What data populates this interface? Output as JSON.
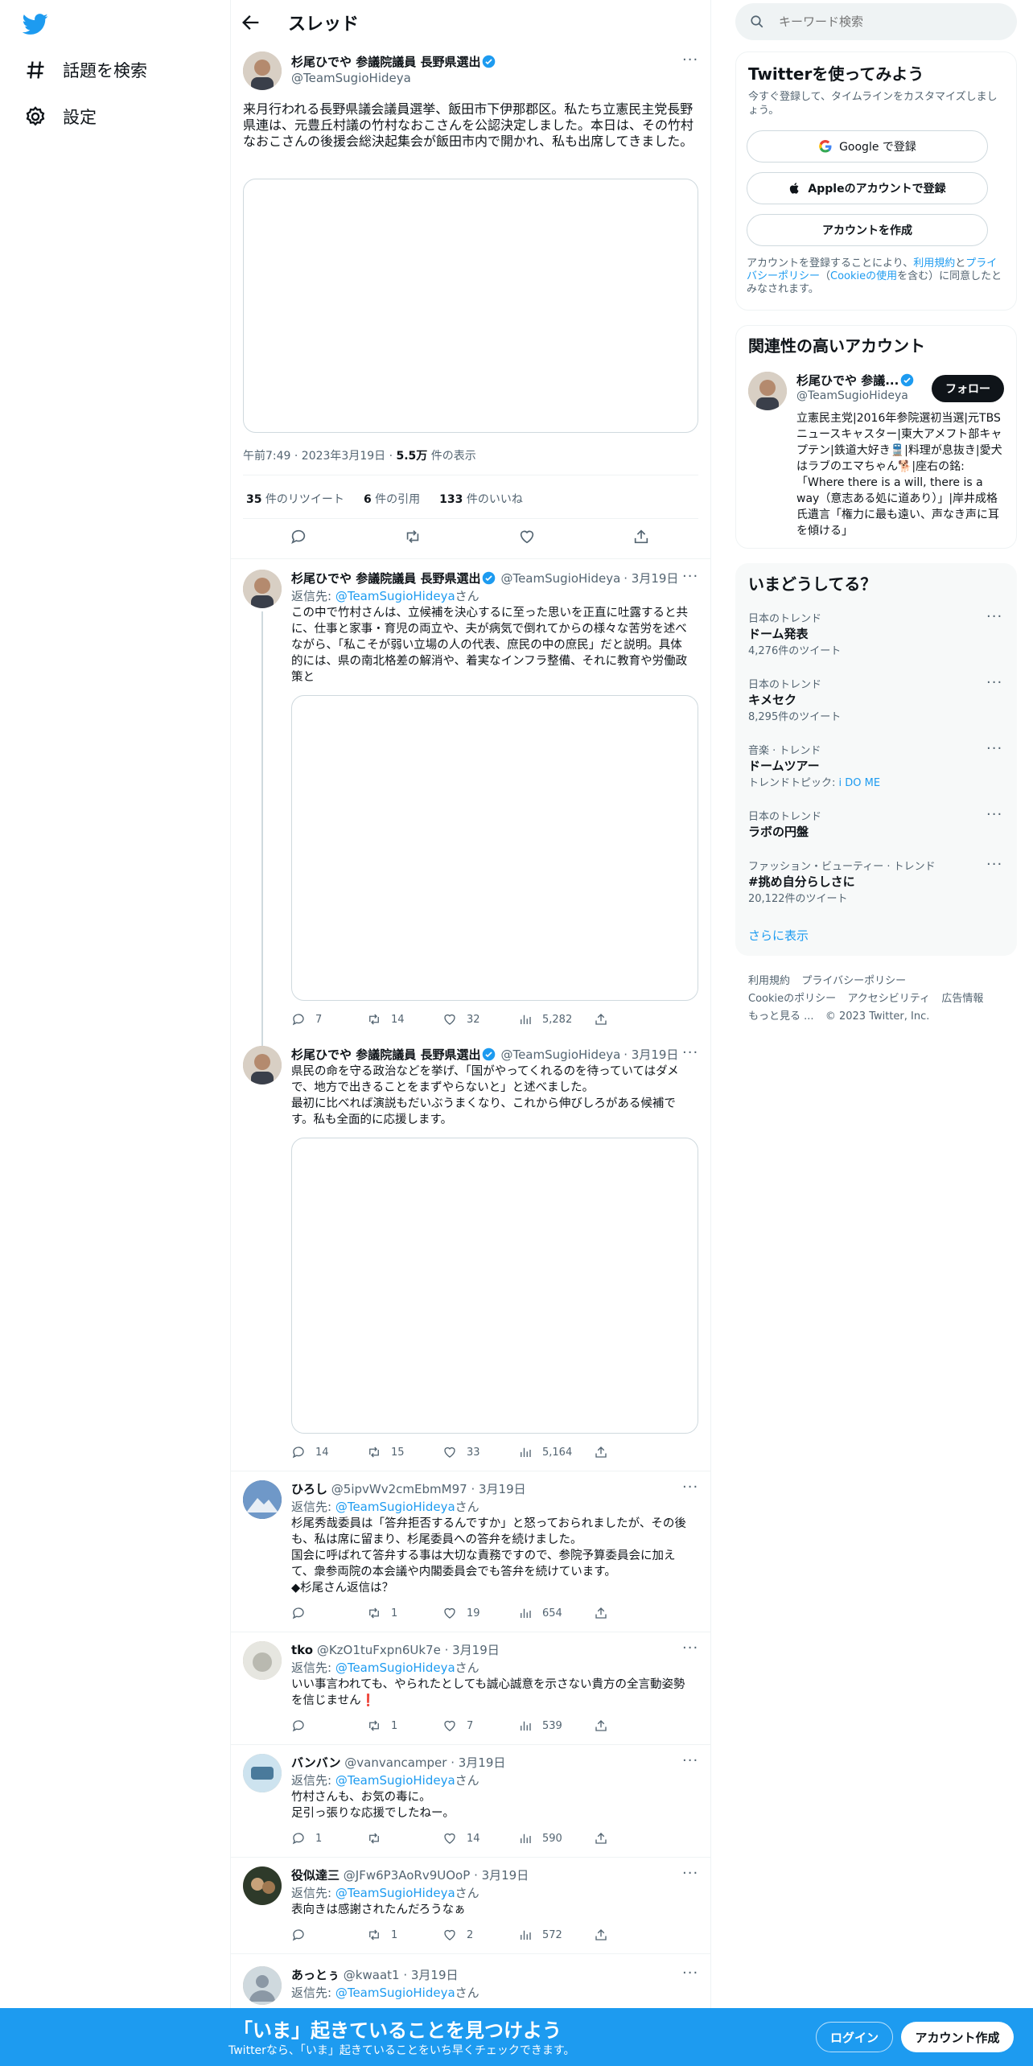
{
  "nav": {
    "explore_label": "話題を検索",
    "settings_label": "設定"
  },
  "header": {
    "title": "スレッド"
  },
  "main_tweet": {
    "name": "杉尾ひでや 参議院議員 長野県選出",
    "handle": "@TeamSugioHideya",
    "text": "来月行われる長野県議会議員選挙、飯田市下伊那郡区。私たち立憲民主党長野県連は、元豊丘村議の竹村なおこさんを公認決定しました。本日は、その竹村なおこさんの後援会総決起集会が飯田市内で開かれ、私も出席してきました。",
    "time": "午前7:49 · 2023年3月19日 · ",
    "views_count": "5.5万",
    "views_label": " 件の表示",
    "retweets_count": "35",
    "retweets_label": " 件のリツイート",
    "quotes_count": "6",
    "quotes_label": " 件の引用",
    "likes_count": "133",
    "likes_label": " 件のいいね"
  },
  "thread": [
    {
      "name": "杉尾ひでや 参議院議員 長野県選出",
      "handle": "@TeamSugioHideya",
      "date": "· 3月19日",
      "reply_prefix": "返信先: ",
      "reply_to": "@TeamSugioHideya",
      "reply_suffix": "さん",
      "text": "この中で竹村さんは、立候補を決心するに至った思いを正直に吐露すると共に、仕事と家事・育児の両立や、夫が病気で倒れてからの様々な苦労を述べながら、「私こそが弱い立場の人の代表、庶民の中の庶民」だと説明。具体的には、県の南北格差の解消や、着実なインフラ整備、それに教育や労働政策と",
      "replies": "7",
      "retweets": "14",
      "likes": "32",
      "views": "5,282"
    },
    {
      "name": "杉尾ひでや 参議院議員 長野県選出",
      "handle": "@TeamSugioHideya",
      "date": "· 3月19日",
      "text": "県民の命を守る政治などを挙げ、「国がやってくれるのを待っていてはダメで、地方で出きることをまずやらないと」と述べました。\n最初に比べれば演説もだいぶうまくなり、これから伸びしろがある候補です。私も全面的に応援します。",
      "replies": "14",
      "retweets": "15",
      "likes": "33",
      "views": "5,164"
    }
  ],
  "replies": [
    {
      "name": "ひろし",
      "handle": "@5ipvWv2cmEbmM97",
      "date": "· 3月19日",
      "reply_prefix": "返信先: ",
      "reply_to": "@TeamSugioHideya",
      "reply_suffix": "さん",
      "text": "杉尾秀哉委員は「答弁拒否するんですか」と怒っておられましたが、その後も、私は席に留まり、杉尾委員への答弁を続けました。\n国会に呼ばれて答弁する事は大切な責務ですので、参院予算委員会に加えて、衆参両院の本会議や内閣委員会でも答弁を続けています。\n◆杉尾さん返信は？",
      "replies": "",
      "retweets": "1",
      "likes": "19",
      "views": "654"
    },
    {
      "name": "tko",
      "handle": "@KzO1tuFxpn6Uk7e",
      "date": "· 3月19日",
      "reply_prefix": "返信先: ",
      "reply_to": "@TeamSugioHideya",
      "reply_suffix": "さん",
      "text": "いい事言われても、やられたとしても誠心誠意を示さない貴方の全言動姿勢を信じません❗",
      "replies": "",
      "retweets": "1",
      "likes": "7",
      "views": "539"
    },
    {
      "name": "バンバン",
      "handle": "@vanvancamper",
      "date": "· 3月19日",
      "reply_prefix": "返信先: ",
      "reply_to": "@TeamSugioHideya",
      "reply_suffix": "さん",
      "text": "竹村さんも、お気の毒に。\n足引っ張りな応援でしたねー。",
      "replies": "1",
      "retweets": "",
      "likes": "14",
      "views": "590"
    },
    {
      "name": "役似達三",
      "handle": "@JFw6P3AoRv9UOoP",
      "date": "· 3月19日",
      "reply_prefix": "返信先: ",
      "reply_to": "@TeamSugioHideya",
      "reply_suffix": "さん",
      "text": "表向きは感謝されたんだろうなぁ",
      "replies": "",
      "retweets": "1",
      "likes": "2",
      "views": "572"
    },
    {
      "name": "あっとぅ",
      "handle": "@kwaat1",
      "date": "· 3月19日",
      "reply_prefix": "返信先: ",
      "reply_to": "@TeamSugioHideya",
      "reply_suffix": "さん"
    }
  ],
  "search": {
    "placeholder": "キーワード検索"
  },
  "signup": {
    "title": "Twitterを使ってみよう",
    "subtitle": "今すぐ登録して、タイムラインをカスタマイズしましょう。",
    "google_label": "Google で登録",
    "apple_label": "Appleのアカウントで登録",
    "create_label": "アカウントを作成",
    "legal_prefix": "アカウントを登録することにより、",
    "legal_terms": "利用規約",
    "legal_and": "と",
    "legal_privacy": "プライバシーポリシー",
    "legal_paren_open": "（",
    "legal_cookie": "Cookieの使用",
    "legal_suffix": "を含む）に同意したとみなされます。"
  },
  "related": {
    "title": "関連性の高いアカウント",
    "name": "杉尾ひでや 参議...",
    "handle": "@TeamSugioHideya",
    "follow_label": "フォロー",
    "bio": "立憲民主党|2016年参院選初当選|元TBSニュースキャスター|東大アメフト部キャプテン|鉄道大好き🚆|料理が息抜き|愛犬はラブのエマちゃん🐕|座右の銘:「Where there is a will, there is a way（意志ある処に道あり）」|岸井成格氏遺言「権力に最も遠い、声なき声に耳を傾ける」"
  },
  "trends": {
    "title": "いまどうしてる？",
    "items": [
      {
        "meta": "日本のトレンド",
        "name": "ドーム発表",
        "count": "4,276件のツイート"
      },
      {
        "meta": "日本のトレンド",
        "name": "キメセク",
        "count": "8,295件のツイート"
      },
      {
        "meta": "音楽 · トレンド",
        "name": "ドームツアー",
        "count_prefix": "トレンドトピック: ",
        "count_link": "i DO ME"
      },
      {
        "meta": "日本のトレンド",
        "name": "ラボの円盤",
        "count": ""
      },
      {
        "meta": "ファッション・ビューティー · トレンド",
        "name": "#挑め自分らしさに",
        "count": "20,122件のツイート"
      }
    ],
    "show_more": "さらに表示"
  },
  "footer": {
    "terms": "利用規約",
    "privacy": "プライバシーポリシー",
    "cookie": "Cookieのポリシー",
    "accessibility": "アクセシビリティ",
    "ads": "広告情報",
    "more": "もっと見る ...",
    "copyright": "© 2023 Twitter, Inc."
  },
  "bottom_bar": {
    "title": "「いま」起きていることを見つけよう",
    "subtitle": "Twitterなら、「いま」起きていることをいち早くチェックできます。",
    "login_label": "ログイン",
    "signup_label": "アカウント作成"
  },
  "colors": {
    "brand": "#1d9bf0",
    "text": "#0f1419",
    "muted": "#536471"
  }
}
